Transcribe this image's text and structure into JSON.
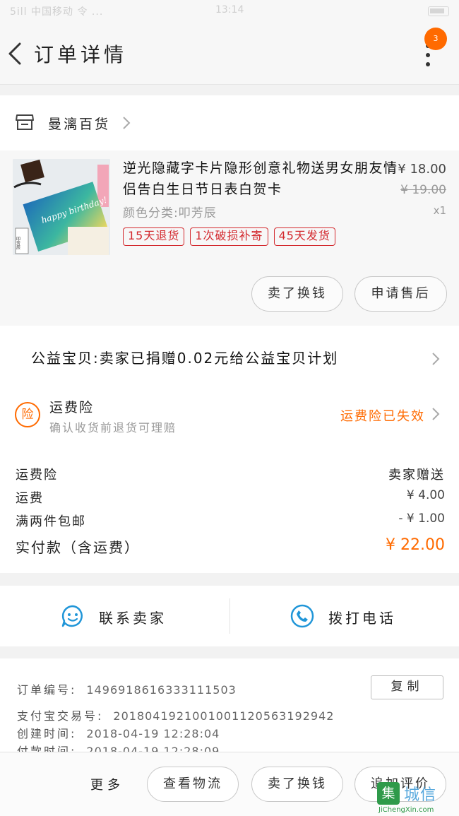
{
  "status_bar": {
    "left": "5ill 中国移动 令 ...",
    "time": "13:14"
  },
  "nav": {
    "title": "订单详情",
    "badge_count": "3"
  },
  "shop": {
    "name": "曼漓百货"
  },
  "item": {
    "title": "逆光隐藏字卡片隐形创意礼物送男女朋友情侣告白生日节日表白贺卡",
    "sku": "颜色分类:叩芳辰",
    "price": "¥ 18.00",
    "original_price": "¥ 19.00",
    "quantity": "x1",
    "tags": [
      "15天退货",
      "1次破损补寄",
      "45天发货"
    ],
    "thumb_label": "叩芳辰",
    "thumb_script": "happy birthday!",
    "buttons": {
      "swap": "卖了换钱",
      "after_sale": "申请售后"
    }
  },
  "charity": {
    "text": "公益宝贝:卖家已捐赠0.02元给公益宝贝计划"
  },
  "insurance": {
    "icon_char": "险",
    "title": "运费险",
    "subtitle": "确认收货前退货可理赔",
    "status": "运费险已失效"
  },
  "fees": [
    {
      "label": "运费险",
      "value": "卖家赠送"
    },
    {
      "label": "运费",
      "value": "¥ 4.00"
    },
    {
      "label": "满两件包邮",
      "value": "- ¥ 1.00"
    }
  ],
  "total": {
    "label": "实付款（含运费）",
    "value": "¥ 22.00"
  },
  "contact": {
    "seller_label": "联系卖家",
    "call_label": "拨打电话"
  },
  "order_info": {
    "order_no_label": "订单编号:",
    "order_no": "1496918616333111503",
    "copy_label": "复制",
    "alipay_label": "支付宝交易号:",
    "alipay_no": "2018041921001001120563192942",
    "created_label": "创建时间:",
    "created": "2018-04-19 12:28:04",
    "paid_label": "付款时间:",
    "paid": "2018-04-19 12:28:09"
  },
  "bottom_bar": {
    "more": "更多",
    "logistics": "查看物流",
    "swap": "卖了换钱",
    "review": "追加评价"
  },
  "watermark": {
    "mark": "集",
    "text": "城信",
    "url": "JiChengXin.com"
  },
  "colors": {
    "accent": "#ff6a00",
    "tag_red": "#d3282d",
    "link_blue": "#2196d8"
  }
}
